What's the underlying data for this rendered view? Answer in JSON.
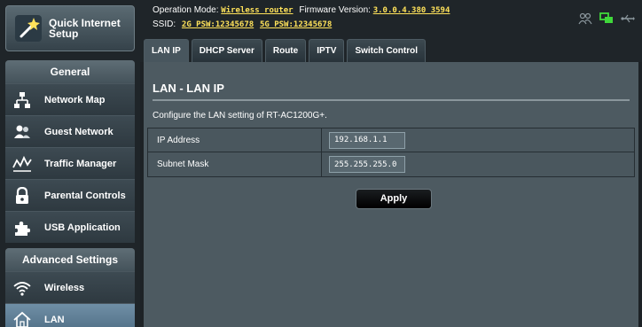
{
  "sidebar": {
    "quick_setup": {
      "label": "Quick Internet Setup",
      "icon": "wand-icon"
    },
    "general": {
      "title": "General",
      "items": [
        {
          "label": "Network Map",
          "icon": "network-map-icon"
        },
        {
          "label": "Guest Network",
          "icon": "guest-network-icon"
        },
        {
          "label": "Traffic Manager",
          "icon": "traffic-manager-icon"
        },
        {
          "label": "Parental Controls",
          "icon": "lock-icon"
        },
        {
          "label": "USB Application",
          "icon": "puzzle-icon"
        }
      ]
    },
    "advanced": {
      "title": "Advanced Settings",
      "items": [
        {
          "label": "Wireless",
          "icon": "wifi-icon"
        },
        {
          "label": "LAN",
          "icon": "home-icon",
          "active": true
        }
      ]
    }
  },
  "topbar": {
    "mode_label": "Operation Mode:",
    "mode_value": "Wireless router",
    "firmware_label": "Firmware Version:",
    "firmware_value": "3.0.0.4.380_3594",
    "ssid_label": "SSID:",
    "ssid_2g": "2G_PSW:12345678",
    "ssid_5g": "5G_PSW:12345678",
    "status_icons": [
      "users-icon",
      "network-status-icon",
      "usb-icon"
    ]
  },
  "tabs": [
    {
      "label": "LAN IP",
      "active": true
    },
    {
      "label": "DHCP Server"
    },
    {
      "label": "Route"
    },
    {
      "label": "IPTV"
    },
    {
      "label": "Switch Control"
    }
  ],
  "content": {
    "title": "LAN - LAN IP",
    "description": "Configure the LAN setting of RT-AC1200G+.",
    "fields": [
      {
        "label": "IP Address",
        "value": "192.168.1.1"
      },
      {
        "label": "Subnet Mask",
        "value": "255.255.255.0"
      }
    ],
    "apply_label": "Apply"
  },
  "colors": {
    "accent_link": "#ffe25a",
    "active_nav": "#5d7d94",
    "content_bg": "#4d5a61",
    "status_green": "#3fd83a"
  }
}
